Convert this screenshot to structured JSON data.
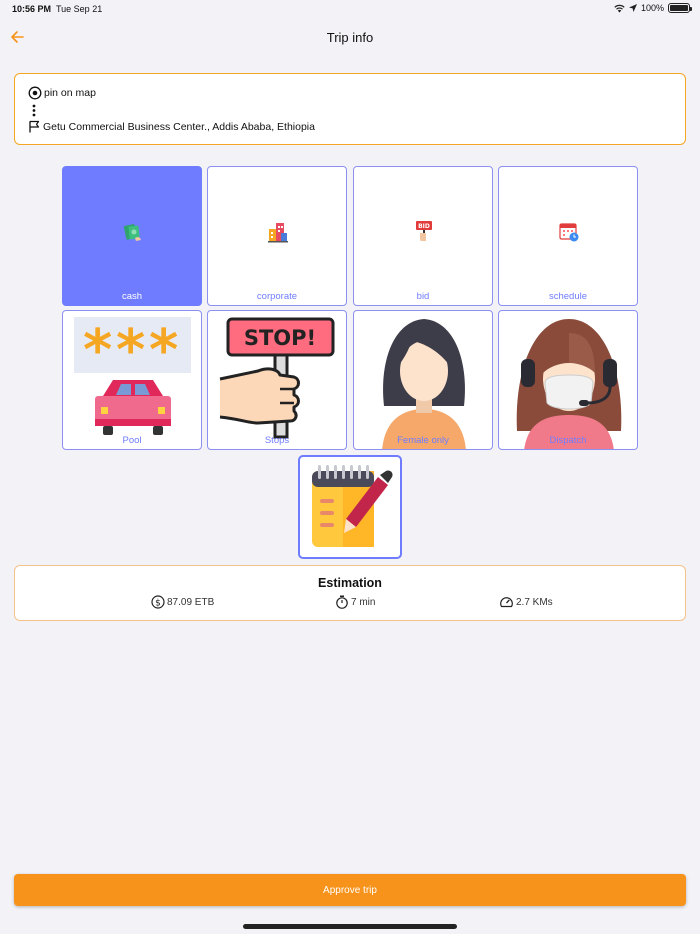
{
  "status_bar": {
    "time": "10:56 PM",
    "date": "Tue Sep 21",
    "battery": "100%"
  },
  "header": {
    "title": "Trip info",
    "back_icon": "arrow-left-icon"
  },
  "route": {
    "origin": "pin on map",
    "destination": "Getu Commercial Business Center., Addis Ababa, Ethiopia"
  },
  "options": [
    {
      "label": "cash",
      "icon": "cash-icon",
      "selected": true
    },
    {
      "label": "corporate",
      "icon": "buildings-icon",
      "selected": false
    },
    {
      "label": "bid",
      "icon": "bid-sign-icon",
      "selected": false
    },
    {
      "label": "schedule",
      "icon": "calendar-clock-icon",
      "selected": false
    },
    {
      "label": "Pool",
      "icon": "pool-car-icon",
      "selected": false
    },
    {
      "label": "Stops",
      "icon": "stop-sign-icon",
      "selected": false
    },
    {
      "label": "Female only",
      "icon": "woman-avatar-icon",
      "selected": false
    },
    {
      "label": "Dispatch",
      "icon": "dispatch-operator-icon",
      "selected": false
    }
  ],
  "notes": {
    "icon": "notepad-pen-icon"
  },
  "estimation": {
    "title": "Estimation",
    "price": "87.09 ETB",
    "duration": "7 min",
    "distance": "2.7 KMs"
  },
  "actions": {
    "approve_label": "Approve trip"
  },
  "colors": {
    "accent": "#F7931A",
    "selected": "#6F7CFF",
    "border": "#8C90F0",
    "background": "#F2F2F7"
  }
}
